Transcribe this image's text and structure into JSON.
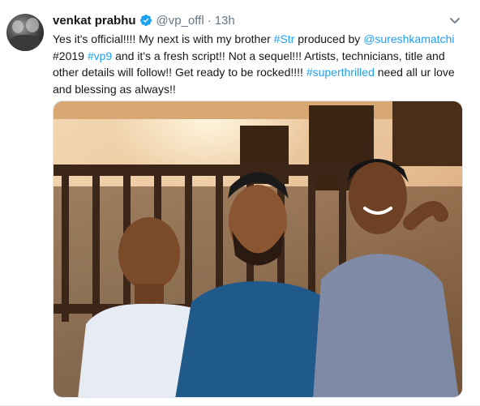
{
  "tweet": {
    "author_name": "venkat prabhu",
    "handle": "@vp_offl",
    "separator": "·",
    "time": "13h",
    "verified": true,
    "text_parts": [
      {
        "t": "Yes it's official!!!! My next is with my brother ",
        "link": false
      },
      {
        "t": "#Str",
        "link": true
      },
      {
        "t": " produced by ",
        "link": false
      },
      {
        "t": "@sureshkamatchi",
        "link": true
      },
      {
        "t": " #2019 ",
        "link": false
      },
      {
        "t": "#vp9",
        "link": true
      },
      {
        "t": " and it's a fresh script!! Not a sequel!!! Artists, technicians, title and other details will follow!! Get ready to be rocked!!!! ",
        "link": false
      },
      {
        "t": "#superthrilled",
        "link": true
      },
      {
        "t": " need all ur love and blessing as always!!",
        "link": false
      }
    ]
  },
  "icons": {
    "avatar": "profile-avatar",
    "verified": "verified-badge-icon",
    "caret": "chevron-down-icon"
  },
  "colors": {
    "link": "#1da1f2",
    "secondary_text": "#657786",
    "primary_text": "#14171a",
    "verified": "#1da1f2"
  }
}
